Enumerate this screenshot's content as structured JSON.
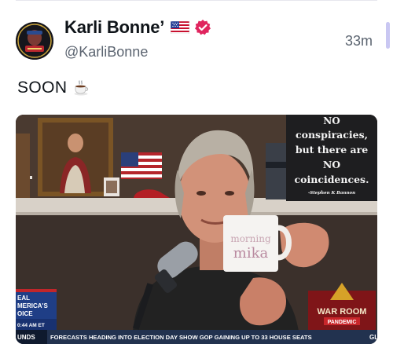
{
  "post": {
    "author_name": "Karli Bonne’",
    "handle": "@KarliBonne",
    "time": "33m",
    "text": "SOON",
    "emoji": "☕"
  },
  "icons": {
    "flag": "us-flag-icon",
    "verified": "verified-badge-icon",
    "emoji": "hot-beverage-icon"
  },
  "media": {
    "sign_lines": [
      "NO",
      "conspiracies,",
      "but there are",
      "NO",
      "coincidences."
    ],
    "sign_attribution": "-Stephen K Bannon",
    "mug_text": [
      "morning",
      "mika"
    ],
    "left_badge_lines": [
      "EAL",
      "MERICA'S",
      "OICE"
    ],
    "left_badge_time": "0:44 AM ET",
    "right_logo_top": "WAR ROOM",
    "right_logo_bottom": "PANDEMIC",
    "ticker_left": "UNDS",
    "ticker_text": "FORECASTS HEADING INTO ELECTION DAY SHOW GOP GAINING UP TO 33 HOUSE SEATS",
    "ticker_right": "GL"
  },
  "colors": {
    "verified": "#e0245e",
    "handle_gray": "#5b6470",
    "scroll_thumb": "#c9c7f2",
    "chyron_bar": "#22324f",
    "warroom_red": "#a41c1f"
  }
}
